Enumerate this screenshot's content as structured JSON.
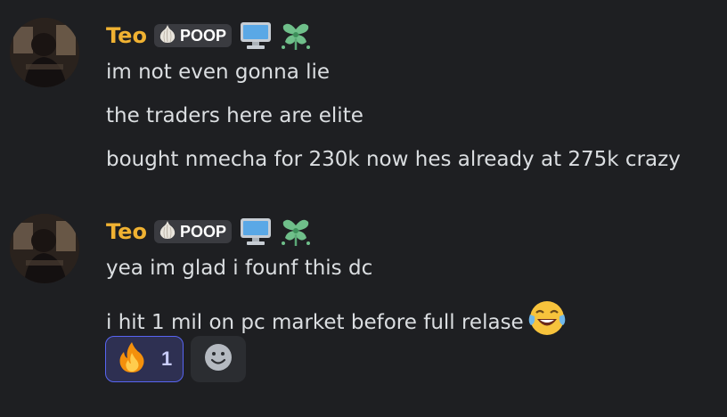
{
  "messages": [
    {
      "author": "Teo",
      "tag": "POOP",
      "lines": [
        "im not even gonna lie",
        "the traders here are elite",
        "bought nmecha for 230k now hes already at 275k crazy"
      ]
    },
    {
      "author": "Teo",
      "tag": "POOP",
      "lines": [
        "yea im glad i founf this dc",
        "i hit 1 mil on pc market before full relase"
      ],
      "reactions": [
        {
          "emoji": "fire-emoji",
          "count": "1"
        }
      ]
    }
  ],
  "colors": {
    "background": "#1e1f22",
    "username": "#f0b232",
    "text": "#dbdee1",
    "reaction_active_border": "#5865f2"
  }
}
